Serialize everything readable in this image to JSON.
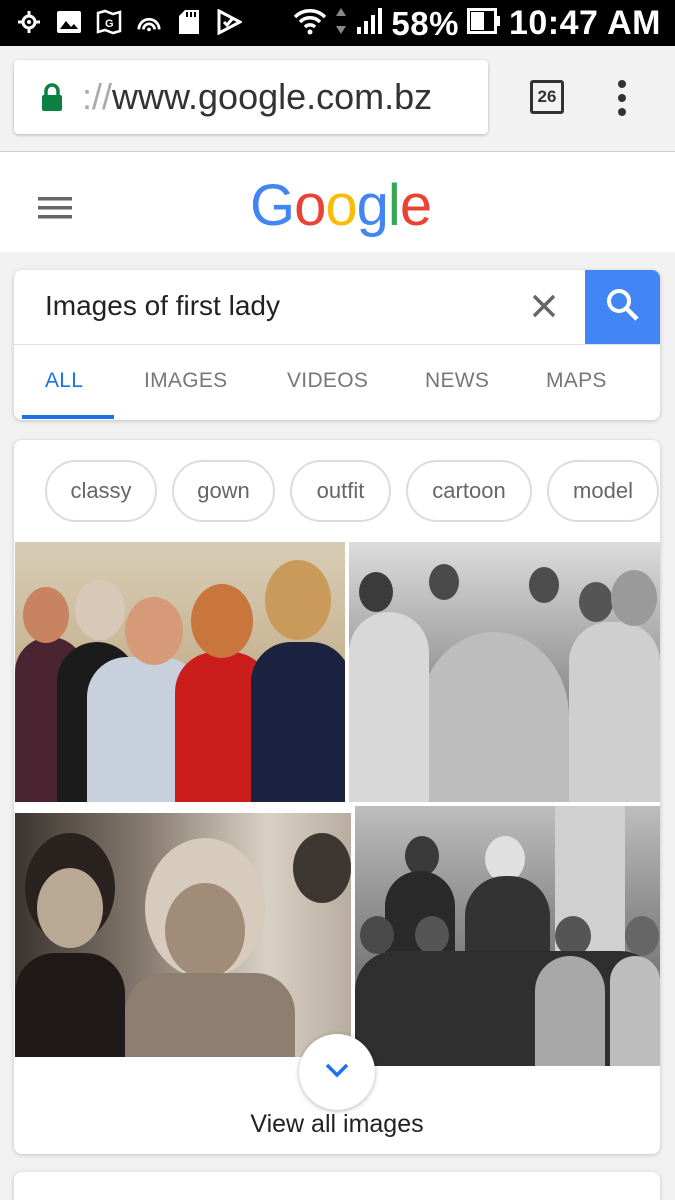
{
  "status_bar": {
    "battery_percent": "58%",
    "time": "10:47 AM",
    "icons": [
      "settings-notification-icon",
      "image-icon",
      "maps-notification-icon",
      "hotspot-icon",
      "sd-card-icon",
      "tasks-icon",
      "wifi-icon",
      "data-arrows-icon",
      "signal-icon",
      "battery-icon"
    ]
  },
  "browser": {
    "url_prefix": "://",
    "url_host": "www.google.com.bz",
    "tab_count": "26",
    "icons": [
      "lock-icon",
      "tabs-icon",
      "overflow-menu-icon"
    ]
  },
  "google": {
    "logo_letters": [
      "G",
      "o",
      "o",
      "g",
      "l",
      "e"
    ],
    "colors": {
      "blue": "#4285f4",
      "red": "#ea4335",
      "yellow": "#fbbc05",
      "green": "#34a853"
    }
  },
  "search": {
    "query": "Images of first lady",
    "tabs": [
      {
        "label": "ALL",
        "active": true
      },
      {
        "label": "IMAGES",
        "active": false
      },
      {
        "label": "VIDEOS",
        "active": false
      },
      {
        "label": "NEWS",
        "active": false
      },
      {
        "label": "MAPS",
        "active": false
      }
    ],
    "accent": "#1a73e8"
  },
  "images": {
    "chips": [
      "classy",
      "gown",
      "outfit",
      "cartoon",
      "model"
    ],
    "view_all_label": "View all images"
  }
}
